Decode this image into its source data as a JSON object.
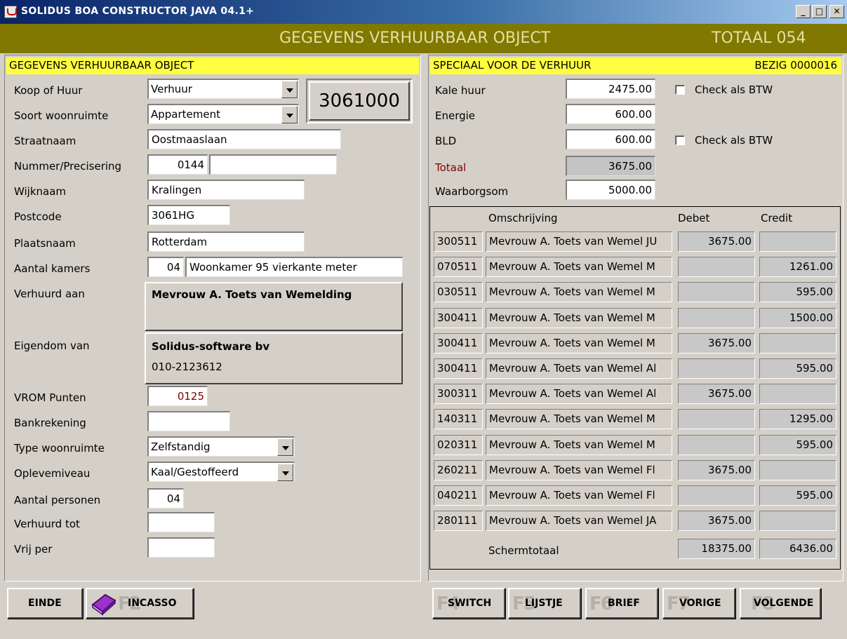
{
  "window": {
    "title": "SOLIDUS BOA CONSTRUCTOR JAVA 04.1+"
  },
  "header": {
    "title": "GEGEVENS VERHUURBAAR OBJECT",
    "total": "TOTAAL  054"
  },
  "left": {
    "section_title": "GEGEVENS VERHUURBAAR OBJECT",
    "code": "3061000",
    "labels": {
      "koop_huur": "Koop of Huur",
      "soort": "Soort woonruimte",
      "straat": "Straatnaam",
      "nummer": "Nummer/Precisering",
      "wijk": "Wijknaam",
      "postcode": "Postcode",
      "plaats": "Plaatsnaam",
      "kamers": "Aantal kamers",
      "verhuurd_aan": "Verhuurd aan",
      "eigendom": "Eigendom van",
      "vrom": "VROM Punten",
      "bank": "Bankrekening",
      "type": "Type woonruimte",
      "oplever": "Oplevemiveau",
      "personen": "Aantal personen",
      "verhuurd_tot": "Verhuurd tot",
      "vrij": "Vrij per"
    },
    "values": {
      "koop_huur": "Verhuur",
      "soort": "Appartement",
      "straat": "Oostmaaslaan",
      "nummer": "0144",
      "precisering": "",
      "wijk": "Kralingen",
      "postcode": "3061HG",
      "plaats": "Rotterdam",
      "kamers": "04",
      "kamers_desc": "Woonkamer 95 vierkante meter",
      "verhuurd_aan_name": "Mevrouw A. Toets van Wemelding",
      "eigendom_name": "Solidus-software bv",
      "eigendom_phone": "010-2123612",
      "vrom": "0125",
      "bank": "",
      "type": "Zelfstandig",
      "oplever": "Kaal/Gestoffeerd",
      "personen": "04",
      "verhuurd_tot": "",
      "vrij": ""
    }
  },
  "right": {
    "section_title": "SPECIAAL VOOR DE VERHUUR",
    "status": "BEZIG  0000016",
    "labels": {
      "kale_huur": "Kale huur",
      "energie": "Energie",
      "bld": "BLD",
      "totaal": "Totaal",
      "waarborg": "Waarborgsom",
      "check_btw": "Check als BTW"
    },
    "values": {
      "kale_huur": "2475.00",
      "energie": "600.00",
      "bld": "600.00",
      "totaal": "3675.00",
      "waarborg": "5000.00"
    },
    "ledger": {
      "headers": {
        "omschrijving": "Omschrijving",
        "debet": "Debet",
        "credit": "Credit"
      },
      "rows": [
        {
          "date": "300511",
          "desc": "Mevrouw A. Toets van Wemel JU",
          "debet": "3675.00",
          "credit": ""
        },
        {
          "date": "070511",
          "desc": "Mevrouw A. Toets van Wemel M",
          "debet": "",
          "credit": "1261.00"
        },
        {
          "date": "030511",
          "desc": "Mevrouw A. Toets van Wemel M",
          "debet": "",
          "credit": "595.00"
        },
        {
          "date": "300411",
          "desc": "Mevrouw A. Toets van Wemel M",
          "debet": "",
          "credit": "1500.00"
        },
        {
          "date": "300411",
          "desc": "Mevrouw A. Toets van Wemel M",
          "debet": "3675.00",
          "credit": ""
        },
        {
          "date": "300411",
          "desc": "Mevrouw A. Toets van Wemel Al",
          "debet": "",
          "credit": "595.00"
        },
        {
          "date": "300311",
          "desc": "Mevrouw A. Toets van Wemel Al",
          "debet": "3675.00",
          "credit": ""
        },
        {
          "date": "140311",
          "desc": "Mevrouw A. Toets van Wemel M",
          "debet": "",
          "credit": "1295.00"
        },
        {
          "date": "020311",
          "desc": "Mevrouw A. Toets van Wemel M",
          "debet": "",
          "credit": "595.00"
        },
        {
          "date": "260211",
          "desc": "Mevrouw A. Toets van Wemel Fl",
          "debet": "3675.00",
          "credit": ""
        },
        {
          "date": "040211",
          "desc": "Mevrouw A. Toets van Wemel Fl",
          "debet": "",
          "credit": "595.00"
        },
        {
          "date": "280111",
          "desc": "Mevrouw A. Toets van Wemel JA",
          "debet": "3675.00",
          "credit": ""
        }
      ],
      "total_label": "Schermtotaal",
      "total_debet": "18375.00",
      "total_credit": "6436.00"
    }
  },
  "buttons": {
    "einde": "EINDE",
    "incasso_key": "F2",
    "incasso": "INCASSO",
    "switch_key": "F4",
    "switch": "SWITCH",
    "lijstje_key": "F5",
    "lijstje": "LIJSTJE",
    "brief_key": "F6",
    "brief": "BRIEF",
    "vorige_key": "F7",
    "vorige": "VORIGE",
    "volgende_key": "F8",
    "volgende": "VOLGENDE"
  }
}
